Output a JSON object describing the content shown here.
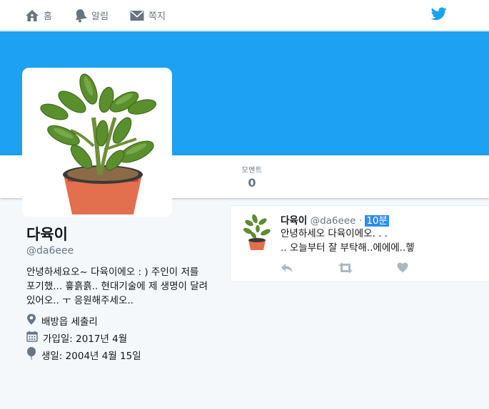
{
  "nav": {
    "home": {
      "label": "홈",
      "icon": "home-icon"
    },
    "notifications": {
      "label": "알림",
      "icon": "bell-icon"
    },
    "messages": {
      "label": "쪽지",
      "icon": "envelope-icon"
    },
    "logo": "twitter-bird-icon"
  },
  "colors": {
    "brand": "#1da1f2",
    "text": "#14171a",
    "muted": "#657786",
    "icon_muted": "#aab8c2",
    "highlight": "#2f8bf0"
  },
  "profile_nav": {
    "stat_label": "모멘트",
    "stat_value": "0"
  },
  "profile": {
    "name": "다육이",
    "handle": "@da6eee",
    "bio": "안녕하세요오~ 다육이에오 : ) 주인이 저를 포기했... 흏흙흙.. 현대기술에 제 생명이 달려있어오.. ㅜ 응원해주세오..",
    "location": "배방읍 세출리",
    "joined": "가입일: 2017년 4월",
    "birthday": "생일: 2004년 4월 15일"
  },
  "tweet": {
    "name": "다육이",
    "handle": "@da6eee",
    "separator": "·",
    "time": "10분",
    "line1": "안녕하세오 다육이에오. . .",
    "line2": ".. 오늘부터 잘 부탁해..에에에..헿",
    "actions": [
      "reply-icon",
      "retweet-icon",
      "like-icon"
    ]
  }
}
